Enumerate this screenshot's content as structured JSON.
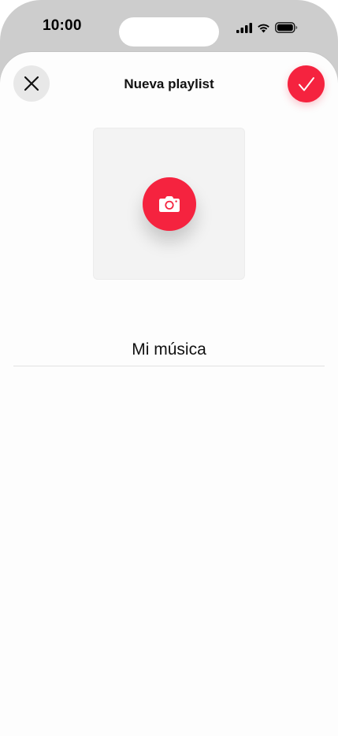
{
  "status_bar": {
    "time": "10:00"
  },
  "nav": {
    "title": "Nueva playlist",
    "close_icon": "close-icon",
    "done_icon": "checkmark-icon"
  },
  "artwork": {
    "icon": "camera-icon"
  },
  "playlist_name": {
    "value": "Mi música"
  },
  "colors": {
    "accent": "#f5233f",
    "sheet_background": "#fdfdfd",
    "frame": "#cdcdcd",
    "artwork_background": "#f3f3f3"
  }
}
